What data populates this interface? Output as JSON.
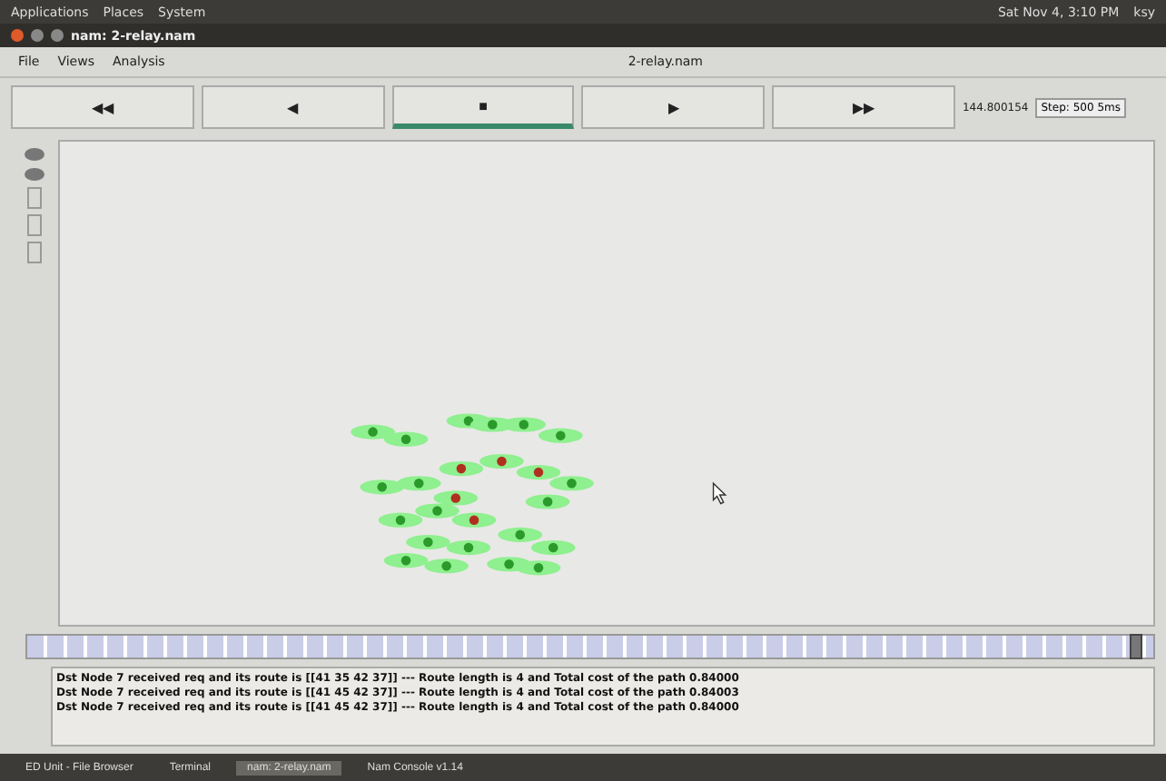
{
  "top_panel": {
    "menus": [
      "Applications",
      "Places",
      "System"
    ],
    "clock": "Sat Nov 4, 3:10 PM",
    "user": "ksy"
  },
  "window": {
    "title": "nam: 2-relay.nam"
  },
  "menubar": {
    "items": [
      "File",
      "Views",
      "Analysis"
    ],
    "file_name": "2-relay.nam"
  },
  "controls": [
    {
      "symbol": "◀◀",
      "selected": false
    },
    {
      "symbol": "◀",
      "selected": false
    },
    {
      "symbol": "■",
      "selected": true
    },
    {
      "symbol": "▶",
      "selected": false
    },
    {
      "symbol": "▶▶",
      "selected": false
    }
  ],
  "time": "144.800154",
  "timeline": {
    "level": 0.99
  },
  "step": "Step: 500 5ms",
  "log": [
    "Dst Node 7 received req and its route is [[41 35 42 37]] --- Route length is 4 and Total cost of the path 0.84000",
    "Dst Node 7 received req and its route is [[41 45 42 37]] --- Route length is 4 and Total cost of the path 0.84003",
    "Dst Node 7 received req and its route is [[41 45 42 37]] --- Route length is 4 and Total cost of the path 0.84000"
  ],
  "taskbar": [
    {
      "label": "ED Unit - File Browser",
      "selected": false
    },
    {
      "label": "Terminal",
      "selected": false
    },
    {
      "label": "nam: 2-relay.nam",
      "selected": true
    },
    {
      "label": "Nam Console v1.14",
      "selected": false
    }
  ]
}
